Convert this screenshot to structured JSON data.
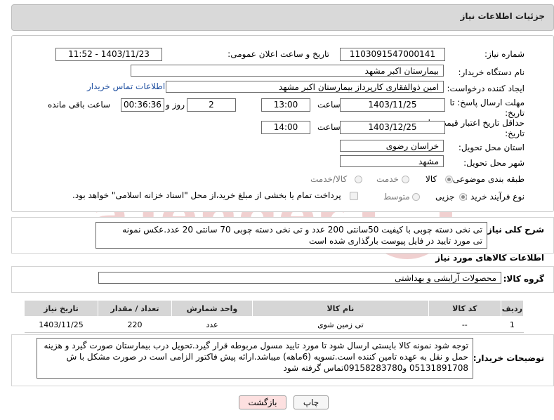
{
  "header": {
    "title": "جزئیات اطلاعات نیاز"
  },
  "form": {
    "need_number_label": "شماره نیاز:",
    "need_number": "1103091547000141",
    "announce_label": "تاریخ و ساعت اعلان عمومی:",
    "announce_value": "1403/11/23 - 11:52",
    "buyer_org_label": "نام دستگاه خریدار:",
    "buyer_org": "بیمارستان اکبر مشهد",
    "requester_label": "ایجاد کننده درخواست:",
    "requester": "امین ذوالفقاری کارپرداز بیمارستان اکبر مشهد",
    "contact_link": "اطلاعات تماس خریدار",
    "deadline_label_1": "مهلت ارسال پاسخ: تا",
    "deadline_label_2": "تاریخ:",
    "deadline_date": "1403/11/25",
    "time_label": "ساعت",
    "deadline_time": "13:00",
    "days_value": "2",
    "days_label": "روز و",
    "remaining_time": "00:36:36",
    "remaining_label": "ساعت باقی مانده",
    "validity_label_1": "حداقل تاریخ اعتبار قیمت: تا",
    "validity_label_2": "تاریخ:",
    "validity_date": "1403/12/25",
    "validity_time": "14:00",
    "province_label": "استان محل تحویل:",
    "province": "خراسان رضوی",
    "city_label": "شهر محل تحویل:",
    "city": "مشهد",
    "category_label": "طبقه بندی موضوعی:",
    "category_options": [
      "کالا",
      "خدمت",
      "کالا/خدمت"
    ],
    "process_label": "نوع فرآیند خرید :",
    "process_options": [
      "جزیی",
      "متوسط"
    ],
    "payment_note": "پرداخت تمام یا بخشی از مبلغ خرید،از محل \"اسناد خزانه اسلامی\" خواهد بود."
  },
  "summary": {
    "label": "شرح کلی نیاز:",
    "line1": "تی نخی دسته چوبی با کیفیت 50سانتی 200 عدد و تی نخی دسته چوبی 70 سانتی 20 عدد.عکس نمونه",
    "line2": "تی مورد تایید در فایل پیوست بارگذاری شده است"
  },
  "goods": {
    "section_title": "اطلاعات کالاهای مورد نیاز",
    "group_label": "گروه کالا:",
    "group_value": "محصولات آرایشی و بهداشتی"
  },
  "table": {
    "headers": [
      "ردیف",
      "کد کالا",
      "نام کالا",
      "واحد شمارش",
      "تعداد / مقدار",
      "تاریخ نیاز"
    ],
    "rows": [
      [
        "1",
        "--",
        "تی زمین شوی",
        "عدد",
        "220",
        "1403/11/25"
      ]
    ]
  },
  "buyer_notes": {
    "label": "توضیحات خریدار:",
    "line1": "توجه شود نمونه کالا بایستی ارسال شود تا مورد تایید مسول مربوطه قرار گیرد.تحویل درب بیمارستان صورت گیرد و هزینه",
    "line2": "حمل و نقل به عهده تامین کننده است.تسویه (6ماهه) میباشد.ارائه پیش فاکتور الزامی است در صورت مشکل با ش",
    "line3": "05131891708 و09158283780تماس گرفته شود"
  },
  "buttons": {
    "print": "چاپ",
    "back": "بازگشت"
  },
  "colors": {
    "header_bg": "#d9d9d9",
    "link": "#1f4fa0",
    "back_btn_bg": "#fde0e0"
  }
}
